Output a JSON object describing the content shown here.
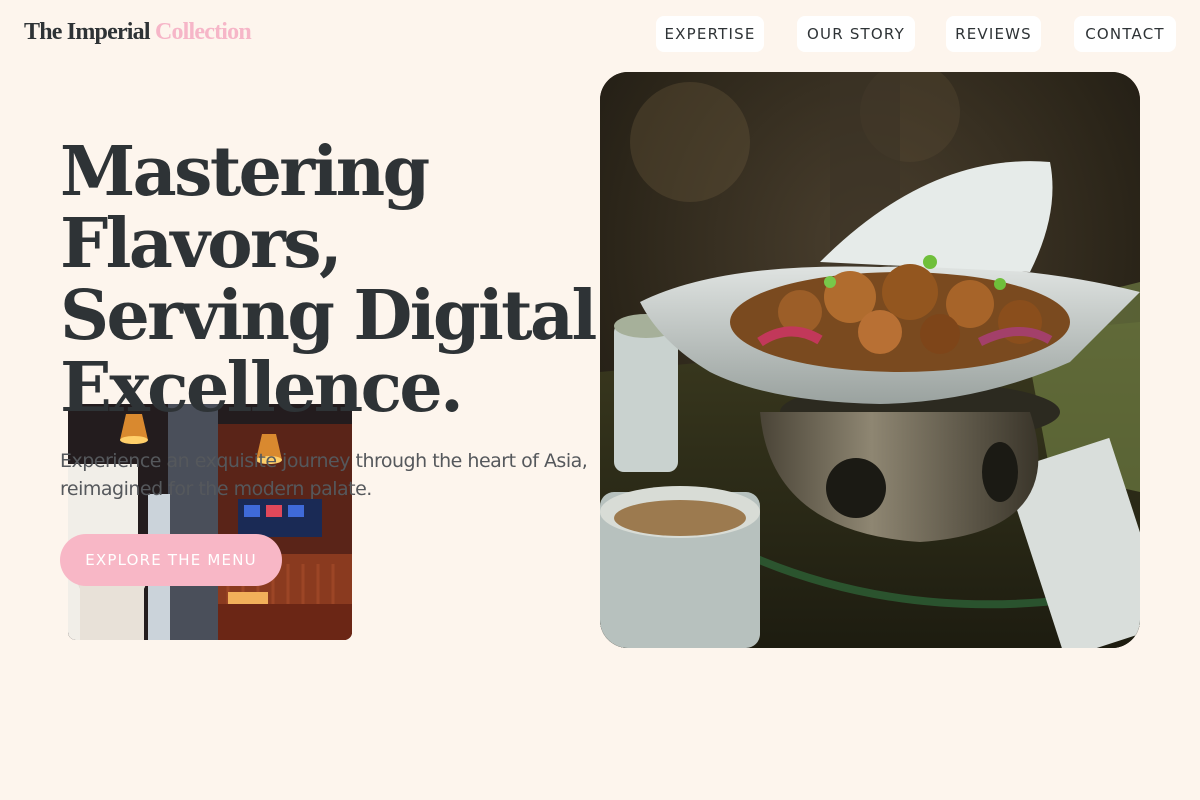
{
  "brand": {
    "name": "The Imperial",
    "accent": "Collection"
  },
  "nav": {
    "items": [
      {
        "label": "EXPERTISE"
      },
      {
        "label": "OUR STORY"
      },
      {
        "label": "REVIEWS"
      },
      {
        "label": "CONTACT"
      }
    ]
  },
  "hero": {
    "headline": "Mastering Flavors, Serving Digital Excellence.",
    "subtext": "Experience an exquisite journey through the heart of Asia, reimagined for the modern palate.",
    "cta_label": "EXPLORE THE MENU"
  },
  "colors": {
    "background": "#fdf5ed",
    "text": "#2e3336",
    "accent_pink": "#f6b6c8",
    "button": "#f8b7c6"
  }
}
